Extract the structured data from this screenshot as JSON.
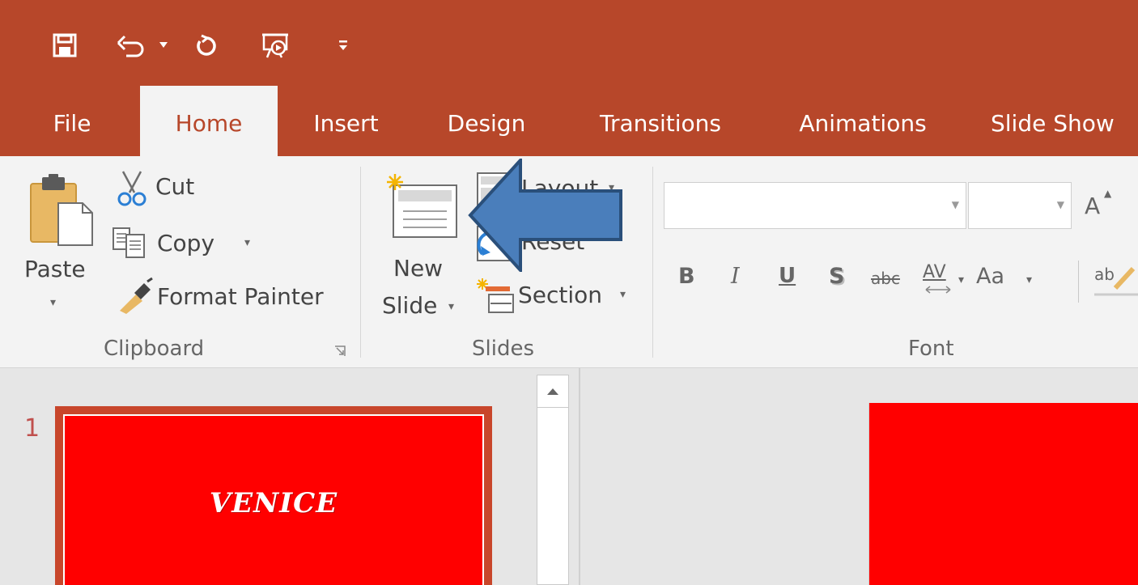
{
  "quick_access": {
    "icons": [
      "save-icon",
      "undo-icon",
      "undo-dropdown-icon",
      "redo-icon",
      "slideshow-from-beginning-icon",
      "customize-qat-icon"
    ]
  },
  "tabs": [
    "File",
    "Home",
    "Insert",
    "Design",
    "Transitions",
    "Animations",
    "Slide Show"
  ],
  "active_tab": "Home",
  "clipboard": {
    "paste": "Paste",
    "cut": "Cut",
    "copy": "Copy",
    "format_painter": "Format Painter",
    "group_label": "Clipboard"
  },
  "slides": {
    "new_line1": "New",
    "new_line2": "Slide",
    "layout": "Layout",
    "reset": "Reset",
    "section": "Section",
    "group_label": "Slides"
  },
  "font": {
    "font_name": "",
    "font_size": "",
    "grow_font": "A",
    "bold": "B",
    "italic": "I",
    "underline": "U",
    "shadow": "S",
    "strikethrough": "abc",
    "spacing": "AV",
    "change_case": "Aa",
    "group_label": "Font"
  },
  "thumbnail": {
    "number": "1",
    "title": "VENICE"
  },
  "colors": {
    "accent": "#b7472a",
    "ribbon": "#f3f3f3",
    "slide": "#ff0000",
    "arrow": "#4a7ebb"
  }
}
